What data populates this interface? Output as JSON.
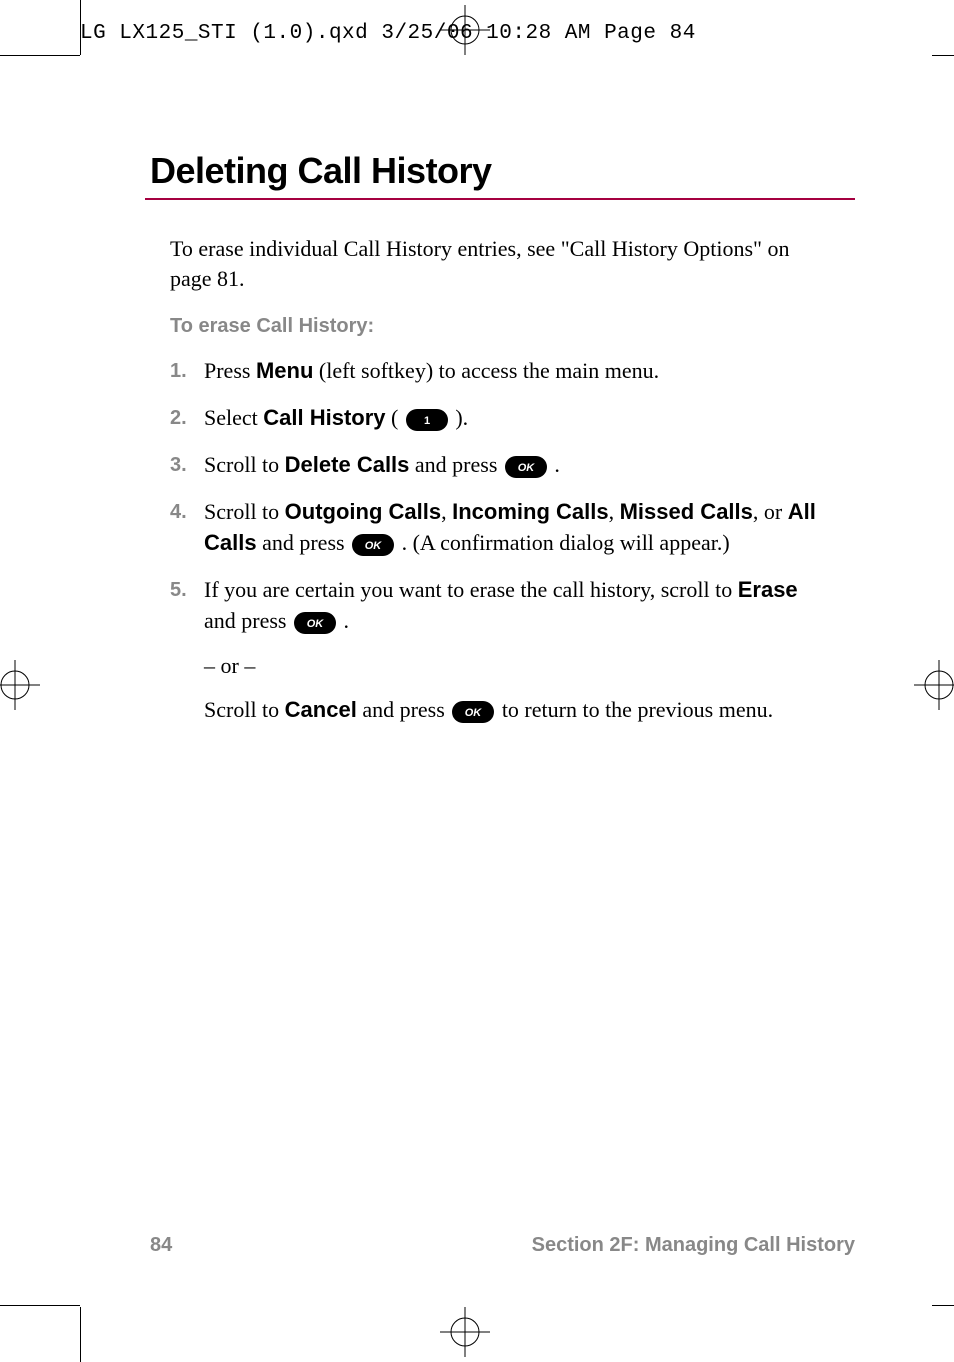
{
  "header_line": "LG LX125_STI (1.0).qxd  3/25/06  10:28 AM  Page 84",
  "title": "Deleting Call History",
  "intro_text": "To erase individual Call History entries, see \"Call History Options\" on page 81.",
  "subhead": "To erase Call History:",
  "steps": [
    {
      "num": "1.",
      "parts": [
        {
          "t": "Press "
        },
        {
          "b": "Menu"
        },
        {
          "t": " (left softkey) to access the main menu."
        }
      ]
    },
    {
      "num": "2.",
      "parts": [
        {
          "t": "Select "
        },
        {
          "b": "Call History"
        },
        {
          "t": " ( "
        },
        {
          "key": "1"
        },
        {
          "t": " )."
        }
      ]
    },
    {
      "num": "3.",
      "parts": [
        {
          "t": "Scroll to "
        },
        {
          "b": "Delete Calls"
        },
        {
          "t": " and press "
        },
        {
          "key": "OK"
        },
        {
          "t": " ."
        }
      ]
    },
    {
      "num": "4.",
      "parts": [
        {
          "t": "Scroll to "
        },
        {
          "b": "Outgoing Calls"
        },
        {
          "t": ", "
        },
        {
          "b": "Incoming Calls"
        },
        {
          "t": ", "
        },
        {
          "b": "Missed Calls"
        },
        {
          "t": ", or "
        },
        {
          "b": "All Calls"
        },
        {
          "t": " and press "
        },
        {
          "key": "OK"
        },
        {
          "t": " . (A confirmation dialog will appear.)"
        }
      ]
    },
    {
      "num": "5.",
      "parts": [
        {
          "t": "If you are certain you want to erase the call history, scroll to "
        },
        {
          "b": "Erase"
        },
        {
          "t": " and press "
        },
        {
          "key": "OK"
        },
        {
          "t": " ."
        }
      ],
      "sub": [
        {
          "parts": [
            {
              "t": "– or –"
            }
          ]
        },
        {
          "parts": [
            {
              "t": "Scroll to "
            },
            {
              "b": "Cancel"
            },
            {
              "t": " and press "
            },
            {
              "key": "OK"
            },
            {
              "t": " to return to the previous menu."
            }
          ]
        }
      ]
    }
  ],
  "footer": {
    "page": "84",
    "section": "Section 2F: Managing Call History"
  }
}
